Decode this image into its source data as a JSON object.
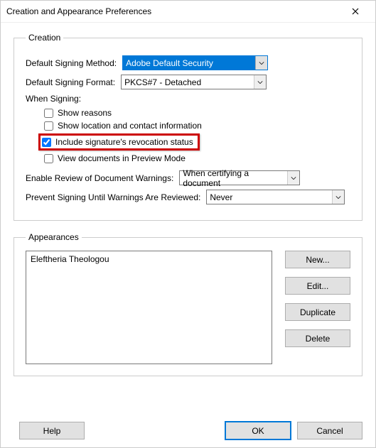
{
  "window": {
    "title": "Creation and Appearance Preferences"
  },
  "creation": {
    "legend": "Creation",
    "method_label": "Default Signing Method:",
    "method_value": "Adobe Default Security",
    "format_label": "Default Signing Format:",
    "format_value": "PKCS#7 - Detached",
    "when_signing_label": "When Signing:",
    "chk_reasons": "Show reasons",
    "chk_location": "Show location and contact information",
    "chk_revocation": "Include signature's revocation status",
    "chk_preview": "View documents in Preview Mode",
    "review_label": "Enable Review of Document Warnings:",
    "review_value": "When certifying a document",
    "prevent_label": "Prevent Signing Until Warnings Are Reviewed:",
    "prevent_value": "Never"
  },
  "appearances": {
    "legend": "Appearances",
    "list": [
      "Eleftheria Theologou"
    ],
    "new": "New...",
    "edit": "Edit...",
    "duplicate": "Duplicate",
    "delete": "Delete"
  },
  "buttons": {
    "help": "Help",
    "ok": "OK",
    "cancel": "Cancel"
  }
}
